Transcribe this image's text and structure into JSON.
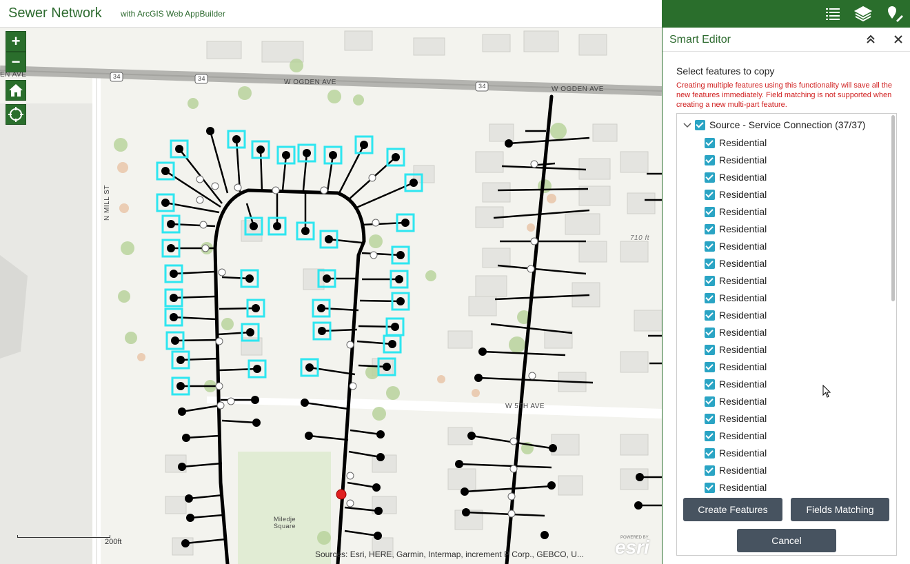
{
  "header": {
    "title": "Sewer Network",
    "subtitle": "with ArcGIS Web AppBuilder"
  },
  "toolbar": {
    "icons": [
      "legend-list-icon",
      "layers-icon",
      "edit-pin-icon"
    ]
  },
  "map": {
    "zoom_in": "+",
    "zoom_out": "−",
    "street_labels": {
      "ogden_left": "W OGDEN AVE",
      "ogden_right": "W OGDEN AVE",
      "ogden_edge": "EN AVE",
      "mill": "N MILL ST",
      "fifth": "W 5TH AVE",
      "elev": "710 ft",
      "park": "Miledje\nSquare"
    },
    "shields": [
      "34",
      "34",
      "34",
      "34"
    ],
    "scale": "200ft",
    "attribution": "Sources: Esri, HERE, Garmin, Intermap, increment P Corp., GEBCO, U...",
    "logo": "esri",
    "powered": "POWERED BY"
  },
  "panel": {
    "title": "Smart Editor",
    "section_title": "Select features to copy",
    "warning": "Creating multiple features using this functionality will save all the new features immediately. Field matching is not supported when creating a new multi-part feature.",
    "group_label": "Source - Service Connection (37/37)",
    "items": [
      "Residential",
      "Residential",
      "Residential",
      "Residential",
      "Residential",
      "Residential",
      "Residential",
      "Residential",
      "Residential",
      "Residential",
      "Residential",
      "Residential",
      "Residential",
      "Residential",
      "Residential",
      "Residential",
      "Residential",
      "Residential",
      "Residential",
      "Residential",
      "Residential"
    ],
    "buttons": {
      "create": "Create Features",
      "fields": "Fields Matching",
      "cancel": "Cancel"
    }
  },
  "colors": {
    "brand_green": "#2a6e2c",
    "selection": "#2ee6f0",
    "button": "#475360",
    "warning": "#d02020"
  }
}
